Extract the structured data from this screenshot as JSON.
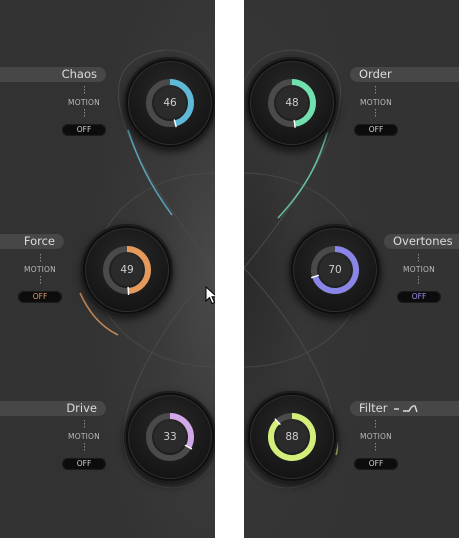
{
  "panels": [
    {
      "controls": [
        {
          "name": "Chaos",
          "motion": "MOTION",
          "toggle": "OFF",
          "value": 46,
          "color": "#5fb8d6",
          "level": 0.46
        },
        {
          "name": "Force",
          "motion": "MOTION",
          "toggle": "OFF",
          "value": 49,
          "color": "#e59a5c",
          "level": 0.49
        },
        {
          "name": "Drive",
          "motion": "MOTION",
          "toggle": "OFF",
          "value": 33,
          "color": "#d0a8e8",
          "level": 0.33
        }
      ]
    },
    {
      "controls": [
        {
          "name": "Order",
          "motion": "MOTION",
          "toggle": "OFF",
          "value": 48,
          "color": "#6fe0ae",
          "level": 0.48
        },
        {
          "name": "Overtones",
          "motion": "MOTION",
          "toggle": "OFF",
          "value": 70,
          "color": "#8a86e8",
          "level": 0.7
        },
        {
          "name": "Filter",
          "motion": "MOTION",
          "toggle": "OFF",
          "value": 88,
          "color": "#d4ee7a",
          "level": 0.88,
          "icon": "filter-shape-icon"
        }
      ]
    }
  ]
}
